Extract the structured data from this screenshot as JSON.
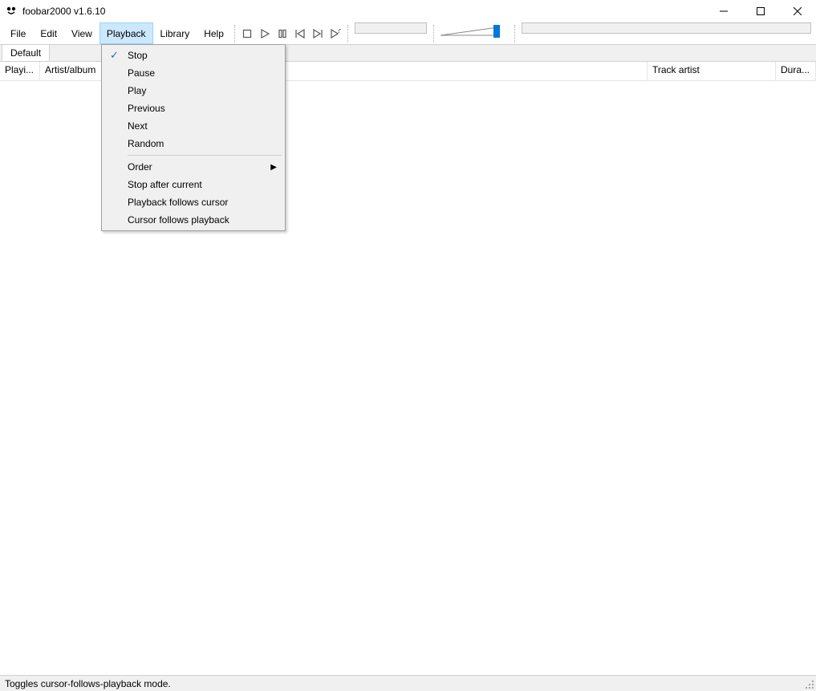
{
  "window": {
    "title": "foobar2000 v1.6.10"
  },
  "menus": {
    "file": "File",
    "edit": "Edit",
    "view": "View",
    "playback": "Playback",
    "library": "Library",
    "help": "Help"
  },
  "playback_menu": {
    "stop": "Stop",
    "pause": "Pause",
    "play": "Play",
    "previous": "Previous",
    "next": "Next",
    "random": "Random",
    "order": "Order",
    "stop_after_current": "Stop after current",
    "playback_follows_cursor": "Playback follows cursor",
    "cursor_follows_playback": "Cursor follows playback",
    "checked": "stop"
  },
  "tabs": {
    "default": "Default"
  },
  "columns": {
    "playing": "Playi...",
    "artist_album": "Artist/album",
    "track_artist": "Track artist",
    "duration": "Dura..."
  },
  "status": {
    "text": "Toggles cursor-follows-playback mode."
  },
  "toolbar_icons": {
    "stop": "stop-icon",
    "play": "play-icon",
    "pause": "pause-icon",
    "prev": "previous-icon",
    "next": "next-icon",
    "random": "random-icon"
  }
}
